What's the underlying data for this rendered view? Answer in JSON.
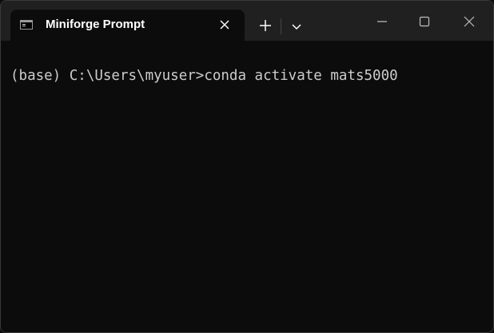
{
  "window": {
    "tab": {
      "icon": "console-icon",
      "title": "Miniforge Prompt",
      "close_icon": "close-icon"
    },
    "new_tab_icon": "plus-icon",
    "dropdown_icon": "chevron-down-icon",
    "controls": {
      "minimize_icon": "minimize-icon",
      "maximize_icon": "maximize-icon",
      "close_icon": "close-icon"
    }
  },
  "terminal": {
    "lines": [
      "(base) C:\\Users\\myuser>conda activate mats5000"
    ]
  },
  "colors": {
    "titlebar": "#202020",
    "terminal_background": "#0c0c0c",
    "terminal_text": "#cccccc"
  }
}
